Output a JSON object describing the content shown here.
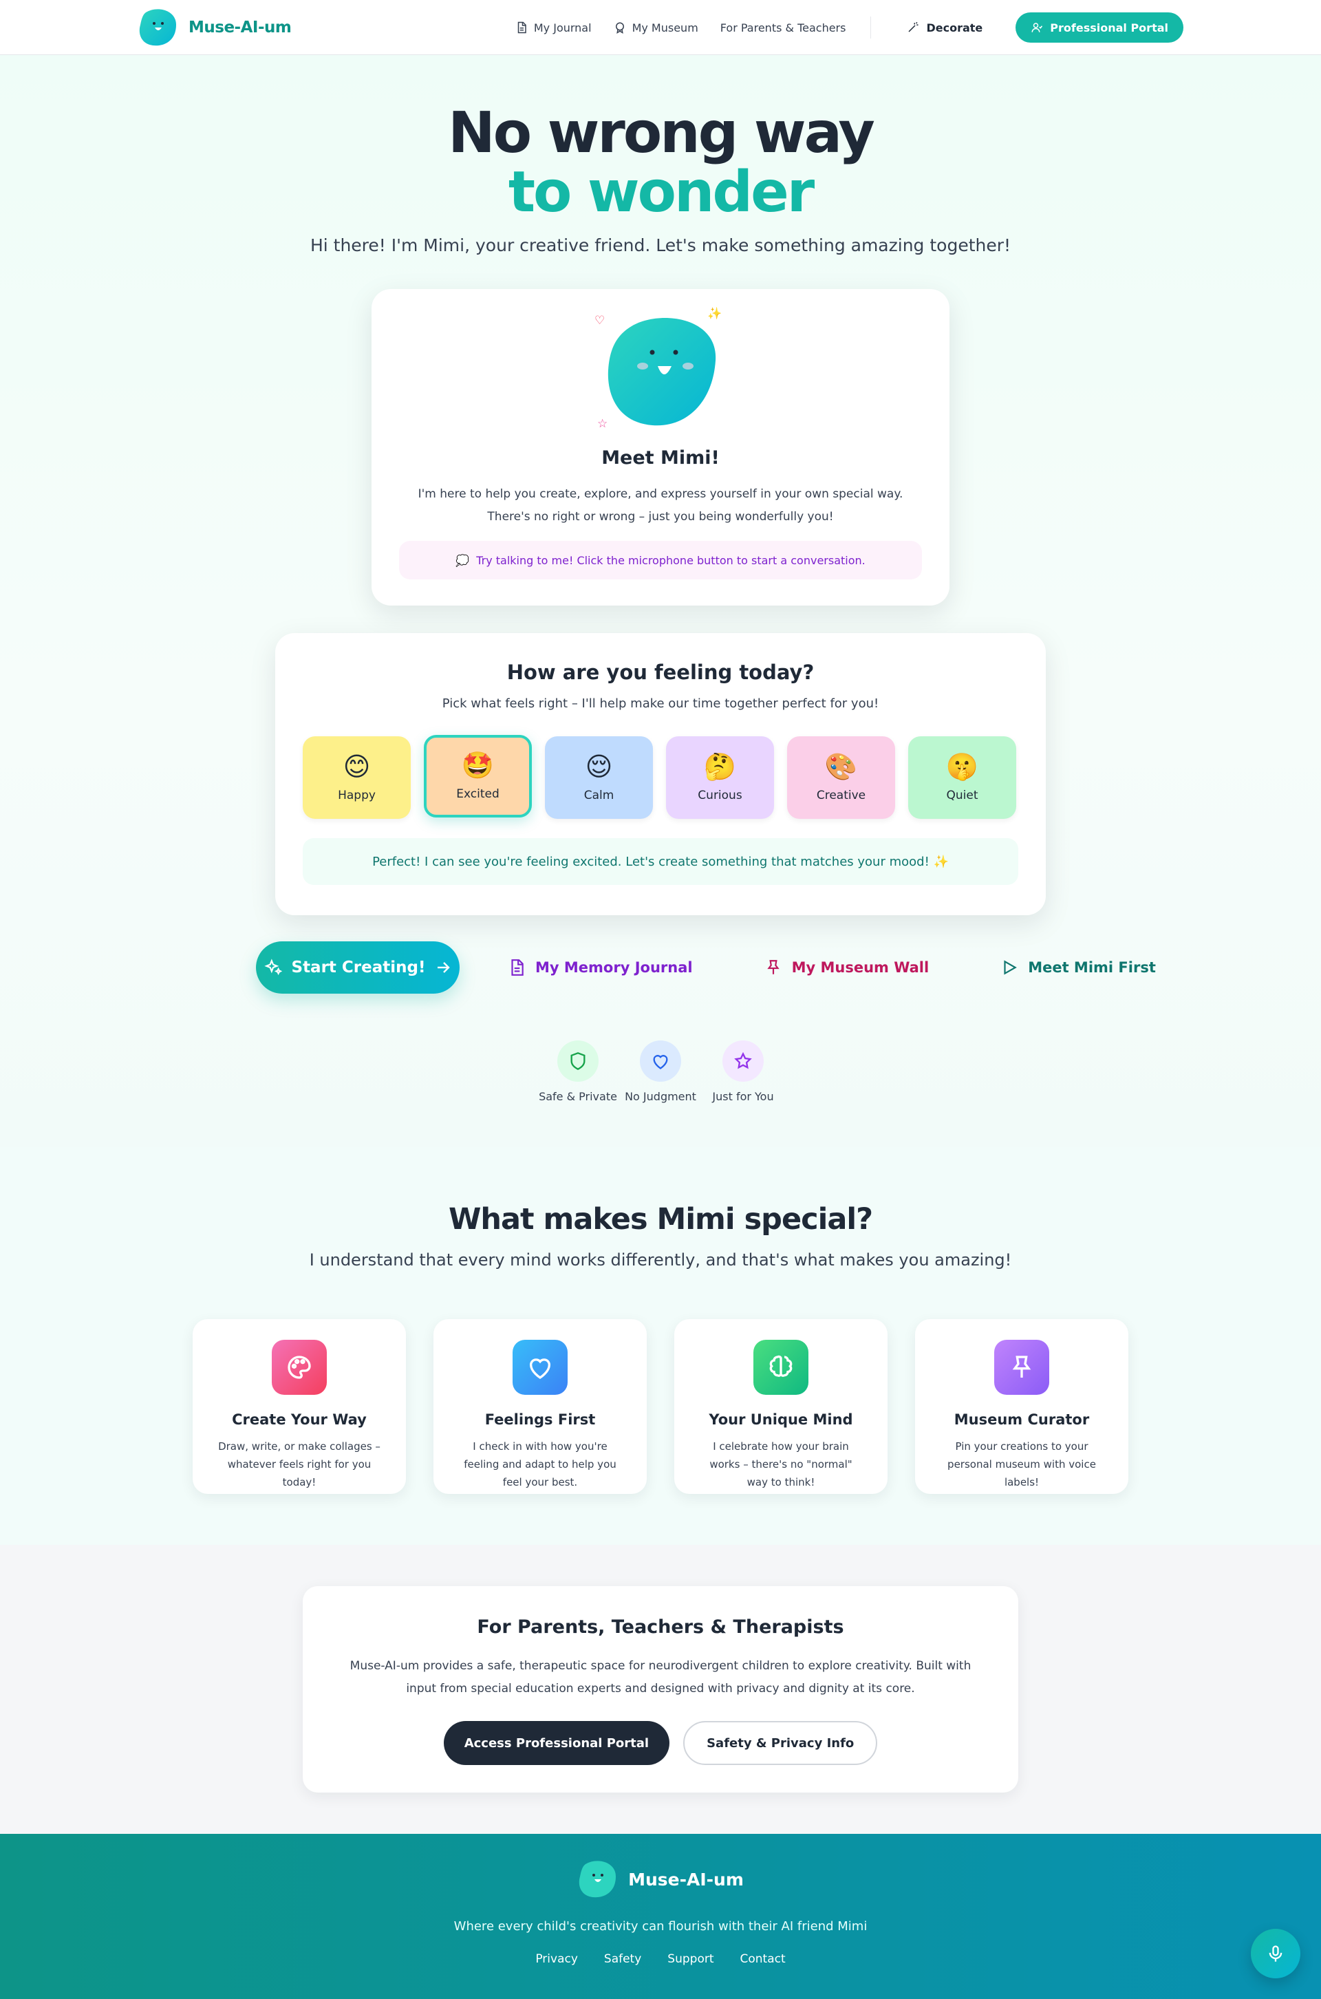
{
  "nav": {
    "brand": "Muse-AI-um",
    "links": [
      "My Journal",
      "My Museum",
      "For Parents & Teachers"
    ],
    "decorate": "Decorate",
    "portal": "Professional Portal"
  },
  "hero": {
    "title_line1": "No wrong way",
    "title_line2": "to wonder",
    "subtitle": "Hi there! I'm Mimi, your creative friend. Let's make something amazing together!"
  },
  "mimi_card": {
    "title": "Meet Mimi!",
    "text": "I'm here to help you create, explore, and express yourself in your own special way. There's no right or wrong – just you being wonderfully you!",
    "tip": "Try talking to me! Click the microphone button to start a conversation."
  },
  "mood": {
    "title": "How are you feeling today?",
    "subtitle": "Pick what feels right – I'll help make our time together perfect for you!",
    "options": [
      {
        "label": "Happy",
        "emoji": "😊",
        "color": "#fdf08a"
      },
      {
        "label": "Excited",
        "emoji": "🤩",
        "color": "#fed7aa"
      },
      {
        "label": "Calm",
        "emoji": "😌",
        "color": "#bfdbfe"
      },
      {
        "label": "Curious",
        "emoji": "🤔",
        "color": "#e9d5ff"
      },
      {
        "label": "Creative",
        "emoji": "🎨",
        "color": "#fbcfe8"
      },
      {
        "label": "Quiet",
        "emoji": "🤫",
        "color": "#bbf7d0"
      }
    ],
    "selected": "Excited",
    "message": "Perfect! I can see you're feeling excited. Let's create something that matches your mood! ✨"
  },
  "ctas": {
    "start": "Start Creating!",
    "journal": "My Memory Journal",
    "museum": "My Museum Wall",
    "meet": "Meet Mimi First"
  },
  "trust": [
    {
      "label": "Safe & Private",
      "icon": "shield-icon",
      "color": "#16a34a"
    },
    {
      "label": "No Judgment",
      "icon": "heart-icon",
      "color": "#2563eb"
    },
    {
      "label": "Just for You",
      "icon": "star-icon",
      "color": "#9333ea"
    }
  ],
  "features": {
    "title": "What makes Mimi special?",
    "subtitle": "I understand that every mind works differently, and that's what makes you amazing!",
    "items": [
      {
        "title": "Create Your Way",
        "desc": "Draw, write, or make collages – whatever feels right for you today!",
        "icon": "palette-icon"
      },
      {
        "title": "Feelings First",
        "desc": "I check in with how you're feeling and adapt to help you feel your best.",
        "icon": "heart-icon"
      },
      {
        "title": "Your Unique Mind",
        "desc": "I celebrate how your brain works – there's no \"normal\" way to think!",
        "icon": "brain-icon"
      },
      {
        "title": "Museum Curator",
        "desc": "Pin your creations to your personal museum with voice labels!",
        "icon": "pin-icon"
      }
    ]
  },
  "parents": {
    "title": "For Parents, Teachers & Therapists",
    "text": "Muse-AI-um provides a safe, therapeutic space for neurodivergent children to explore creativity. Built with input from special education experts and designed with privacy and dignity at its core.",
    "primary": "Access Professional Portal",
    "secondary": "Safety & Privacy Info"
  },
  "footer": {
    "brand": "Muse-AI-um",
    "tagline": "Where every child's creativity can flourish with their AI friend Mimi",
    "links": [
      "Privacy",
      "Safety",
      "Support",
      "Contact"
    ]
  }
}
